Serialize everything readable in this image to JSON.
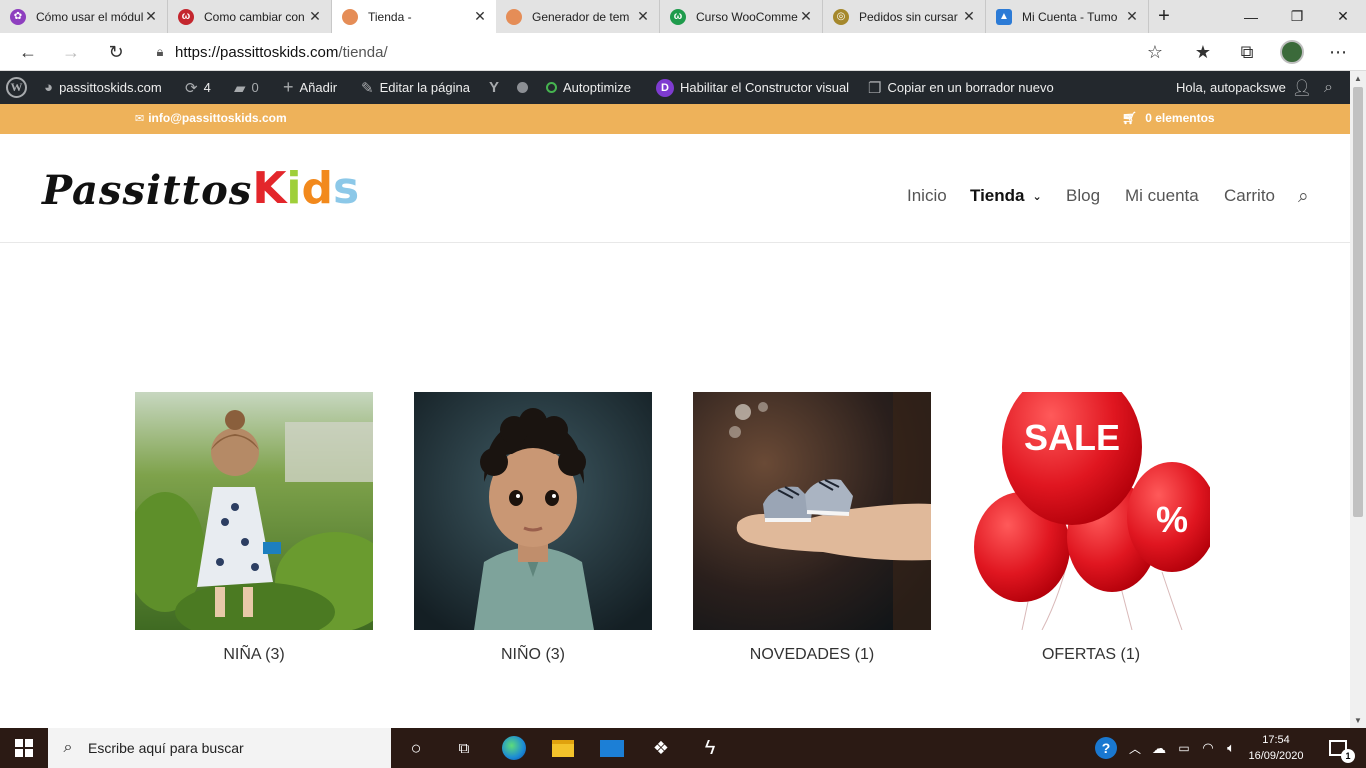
{
  "browser": {
    "tabs": [
      {
        "title": "Cómo usar el módulo",
        "icon": "purple-spiral-icon",
        "color": "#8e3fbf"
      },
      {
        "title": "Como cambiar con",
        "icon": "red-w-icon",
        "color": "#c4262e"
      },
      {
        "title": "Tienda -",
        "icon": "orange-globe-icon",
        "color": "#e58d57",
        "active": true
      },
      {
        "title": "Generador de tem",
        "icon": "orange-globe-icon",
        "color": "#e58d57"
      },
      {
        "title": "Curso WooComme",
        "icon": "green-w-icon",
        "color": "#1f9b4c"
      },
      {
        "title": "Pedidos sin cursar",
        "icon": "yellow-circle-icon",
        "color": "#a5882c"
      },
      {
        "title": "Mi Cuenta - Tumo",
        "icon": "blue-bird-icon",
        "color": "#2c7bd6"
      }
    ],
    "new_tab_label": "+",
    "url_host": "https://passittoskids.com",
    "url_path": "/tienda/"
  },
  "wpbar": {
    "site": "passittoskids.com",
    "updates": "4",
    "comments": "0",
    "add": "Añadir",
    "edit_page": "Editar la página",
    "autoptimize": "Autoptimize",
    "visual_builder": "Habilitar el Constructor visual",
    "copy_draft": "Copiar en un borrador nuevo",
    "greeting": "Hola, autopackswe"
  },
  "topbar": {
    "email": "info@passittoskids.com",
    "cart": "0 elementos",
    "accent": "#eeb25a"
  },
  "header": {
    "logo_a": "Passittos",
    "logo_b": [
      "K",
      "i",
      "d",
      "s"
    ],
    "logo_b_colors": [
      "#e3262b",
      "#9fcf3a",
      "#f2891c",
      "#8cc8e8"
    ],
    "nav": [
      {
        "label": "Inicio"
      },
      {
        "label": "Tienda",
        "current": true
      },
      {
        "label": "Blog"
      },
      {
        "label": "Mi cuenta"
      },
      {
        "label": "Carrito"
      }
    ]
  },
  "categories": [
    {
      "label": "NIÑA (3)"
    },
    {
      "label": "NIÑO (3)"
    },
    {
      "label": "NOVEDADES (1)"
    },
    {
      "label": "OFERTAS (1)"
    }
  ],
  "sale": {
    "word": "SALE",
    "percent": "%"
  },
  "taskbar": {
    "search_placeholder": "Escribe aquí para buscar",
    "time": "17:54",
    "date": "16/09/2020",
    "notifications": "1"
  }
}
